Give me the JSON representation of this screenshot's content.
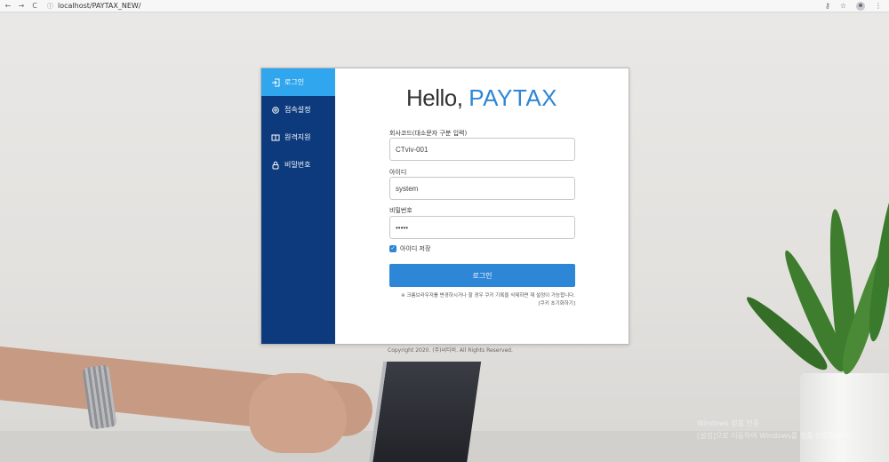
{
  "browser": {
    "back_icon": "←",
    "forward_icon": "→",
    "reload_icon": "C",
    "url": "localhost/PAYTAX_NEW/",
    "key_icon": "⚷",
    "star_icon": "☆",
    "menu_icon": "⋮"
  },
  "sidebar": {
    "items": [
      {
        "label": "로그인",
        "icon": "login-icon",
        "active": true
      },
      {
        "label": "접속설정",
        "icon": "gear-icon",
        "active": false
      },
      {
        "label": "원격지원",
        "icon": "book-icon",
        "active": false
      },
      {
        "label": "비밀번호",
        "icon": "lock-icon",
        "active": false
      }
    ],
    "colors": {
      "bg": "#0c3a7c",
      "active": "#2fa6ee"
    }
  },
  "header": {
    "hello": "Hello,",
    "brand": "PAYTAX",
    "brand_color": "#2e86d6"
  },
  "form": {
    "company_label": "회사코드(대소문자 구분 입력)",
    "company_value": "CTviv-001",
    "id_label": "아이디",
    "id_value": "system",
    "password_label": "비밀번호",
    "password_value": "•••••",
    "remember_label": "아이디 저장",
    "remember_checked": true,
    "login_button": "로그인",
    "notice": "※ 크롬브라우저를 변경하시거나 할 경우 쿠키 기록을 삭제하면 재 설정이 가능합니다.",
    "reset_link": "[쿠키 초기화하기]"
  },
  "footer": {
    "copyright": "Copyright 2020. (주)씨티비. All Rights Reserved."
  },
  "watermark": {
    "line1": "Windows 정품 인증",
    "line2": "[설정]으로 이동하여 Windows를 정품 인증합니다."
  }
}
